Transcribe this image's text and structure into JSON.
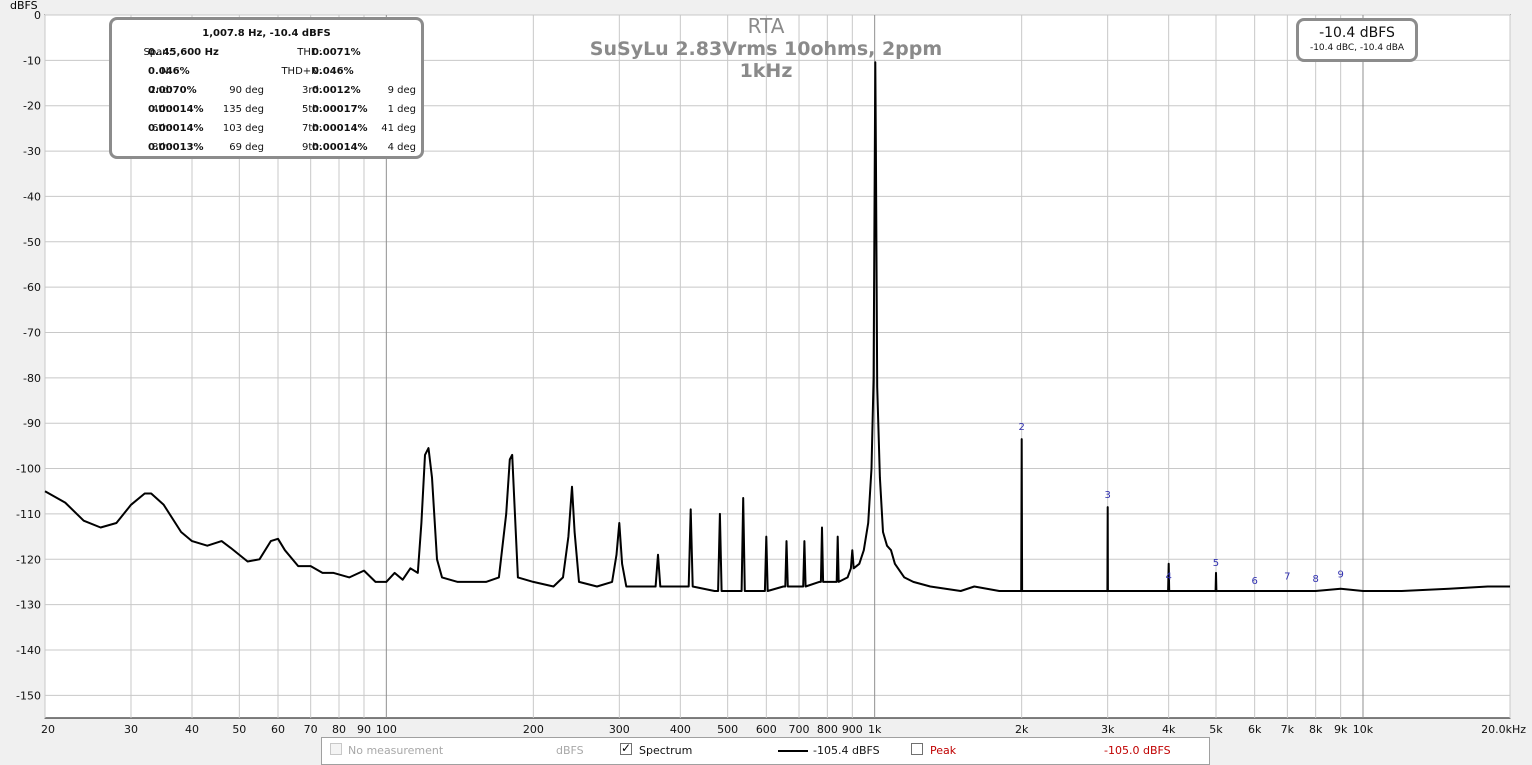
{
  "chart_data": {
    "type": "line",
    "title": "RTA",
    "subtitle": "SuSyLu 2.83Vrms 10ohms, 2ppm 1kHz",
    "ylabel": "dBFS",
    "x_scale": "log",
    "xlim": [
      20,
      20000
    ],
    "ylim": [
      -155,
      0
    ],
    "grid": true,
    "y_ticks": [
      "0",
      "-10",
      "-20",
      "-30",
      "-40",
      "-50",
      "-60",
      "-70",
      "-80",
      "-90",
      "-100",
      "-110",
      "-120",
      "-130",
      "-140",
      "-150"
    ],
    "x_ticks": [
      {
        "v": 20,
        "label": "20"
      },
      {
        "v": 30,
        "label": "30"
      },
      {
        "v": 40,
        "label": "40"
      },
      {
        "v": 50,
        "label": "50"
      },
      {
        "v": 60,
        "label": "60"
      },
      {
        "v": 70,
        "label": "70"
      },
      {
        "v": 80,
        "label": "80"
      },
      {
        "v": 90,
        "label": "90"
      },
      {
        "v": 100,
        "label": "100"
      },
      {
        "v": 200,
        "label": "200"
      },
      {
        "v": 300,
        "label": "300"
      },
      {
        "v": 400,
        "label": "400"
      },
      {
        "v": 500,
        "label": "500"
      },
      {
        "v": 600,
        "label": "600"
      },
      {
        "v": 700,
        "label": "700"
      },
      {
        "v": 800,
        "label": "800"
      },
      {
        "v": 900,
        "label": "900"
      },
      {
        "v": 1000,
        "label": "1k"
      },
      {
        "v": 2000,
        "label": "2k"
      },
      {
        "v": 3000,
        "label": "3k"
      },
      {
        "v": 4000,
        "label": "4k"
      },
      {
        "v": 5000,
        "label": "5k"
      },
      {
        "v": 6000,
        "label": "6k"
      },
      {
        "v": 7000,
        "label": "7k"
      },
      {
        "v": 8000,
        "label": "8k"
      },
      {
        "v": 9000,
        "label": "9k"
      },
      {
        "v": 10000,
        "label": "10k"
      },
      {
        "v": 20000,
        "label": "20.0kHz"
      }
    ],
    "series": [
      {
        "name": "Spectrum",
        "color": "#000000",
        "points": [
          [
            20,
            -105
          ],
          [
            22,
            -107.5
          ],
          [
            24,
            -111.5
          ],
          [
            26,
            -113
          ],
          [
            28,
            -112
          ],
          [
            30,
            -108
          ],
          [
            32,
            -105.5
          ],
          [
            33,
            -105.5
          ],
          [
            35,
            -108
          ],
          [
            38,
            -114
          ],
          [
            40,
            -116
          ],
          [
            43,
            -117
          ],
          [
            46,
            -116
          ],
          [
            48,
            -117.5
          ],
          [
            52,
            -120.5
          ],
          [
            55,
            -120
          ],
          [
            58,
            -116
          ],
          [
            60,
            -115.5
          ],
          [
            62,
            -118
          ],
          [
            66,
            -121.5
          ],
          [
            70,
            -121.5
          ],
          [
            74,
            -123
          ],
          [
            78,
            -123
          ],
          [
            84,
            -124
          ],
          [
            90,
            -122.5
          ],
          [
            95,
            -125
          ],
          [
            100,
            -125
          ],
          [
            104,
            -123
          ],
          [
            108,
            -124.5
          ],
          [
            112,
            -122
          ],
          [
            116,
            -123
          ],
          [
            118,
            -112
          ],
          [
            120,
            -97
          ],
          [
            122,
            -95.5
          ],
          [
            124,
            -102
          ],
          [
            127,
            -120
          ],
          [
            130,
            -124
          ],
          [
            140,
            -125
          ],
          [
            150,
            -125
          ],
          [
            160,
            -125
          ],
          [
            170,
            -124
          ],
          [
            176,
            -110
          ],
          [
            179,
            -98
          ],
          [
            181,
            -97
          ],
          [
            183,
            -108
          ],
          [
            186,
            -124
          ],
          [
            200,
            -125
          ],
          [
            220,
            -126
          ],
          [
            230,
            -124
          ],
          [
            236,
            -115
          ],
          [
            240,
            -104
          ],
          [
            243,
            -114
          ],
          [
            248,
            -125
          ],
          [
            270,
            -126
          ],
          [
            290,
            -125
          ],
          [
            296,
            -119
          ],
          [
            300,
            -112
          ],
          [
            304,
            -121
          ],
          [
            310,
            -126
          ],
          [
            340,
            -126
          ],
          [
            356,
            -126
          ],
          [
            360,
            -119
          ],
          [
            364,
            -126
          ],
          [
            400,
            -126
          ],
          [
            416,
            -126
          ],
          [
            420,
            -109
          ],
          [
            424,
            -126
          ],
          [
            470,
            -127
          ],
          [
            478,
            -127
          ],
          [
            482,
            -110
          ],
          [
            486,
            -127
          ],
          [
            528,
            -127
          ],
          [
            534,
            -127
          ],
          [
            538,
            -106.5
          ],
          [
            542,
            -127
          ],
          [
            590,
            -127
          ],
          [
            596,
            -127
          ],
          [
            600,
            -115
          ],
          [
            604,
            -127
          ],
          [
            650,
            -126
          ],
          [
            656,
            -126
          ],
          [
            660,
            -116
          ],
          [
            664,
            -126
          ],
          [
            708,
            -126
          ],
          [
            714,
            -126
          ],
          [
            718,
            -116
          ],
          [
            722,
            -126
          ],
          [
            770,
            -125
          ],
          [
            776,
            -125
          ],
          [
            780,
            -113
          ],
          [
            784,
            -125
          ],
          [
            830,
            -125
          ],
          [
            836,
            -125
          ],
          [
            840,
            -115
          ],
          [
            844,
            -125
          ],
          [
            880,
            -124
          ],
          [
            894,
            -122
          ],
          [
            900,
            -118
          ],
          [
            906,
            -122
          ],
          [
            930,
            -121
          ],
          [
            950,
            -118
          ],
          [
            970,
            -112
          ],
          [
            985,
            -100
          ],
          [
            995,
            -80
          ],
          [
            1000,
            -35
          ],
          [
            1003,
            -10.4
          ],
          [
            1006,
            -30
          ],
          [
            1012,
            -82
          ],
          [
            1025,
            -102
          ],
          [
            1040,
            -114
          ],
          [
            1060,
            -117
          ],
          [
            1080,
            -118
          ],
          [
            1100,
            -121
          ],
          [
            1150,
            -124
          ],
          [
            1200,
            -125
          ],
          [
            1300,
            -126
          ],
          [
            1500,
            -127
          ],
          [
            1600,
            -126
          ],
          [
            1800,
            -127
          ],
          [
            1990,
            -127
          ],
          [
            1996,
            -127
          ],
          [
            2000,
            -93.5
          ],
          [
            2004,
            -127
          ],
          [
            2200,
            -127
          ],
          [
            2500,
            -127
          ],
          [
            2990,
            -127
          ],
          [
            2996,
            -127
          ],
          [
            3000,
            -108.5
          ],
          [
            3004,
            -127
          ],
          [
            3400,
            -127
          ],
          [
            3990,
            -127
          ],
          [
            4000,
            -121
          ],
          [
            4010,
            -127
          ],
          [
            4990,
            -127
          ],
          [
            5000,
            -123
          ],
          [
            5010,
            -127
          ],
          [
            6000,
            -127
          ],
          [
            7000,
            -127
          ],
          [
            8000,
            -127
          ],
          [
            9000,
            -126.5
          ],
          [
            10000,
            -127
          ],
          [
            12000,
            -127
          ],
          [
            15000,
            -126.5
          ],
          [
            18000,
            -126
          ],
          [
            20000,
            -126
          ]
        ]
      }
    ],
    "harmonic_markers": [
      {
        "label": "2",
        "freq": 2000,
        "db": -91.5
      },
      {
        "label": "3",
        "freq": 3000,
        "db": -106.5
      },
      {
        "label": "4",
        "freq": 4000,
        "db": -124.5
      },
      {
        "label": "5",
        "freq": 5000,
        "db": -121.5
      },
      {
        "label": "6",
        "freq": 6000,
        "db": -125.5
      },
      {
        "label": "7",
        "freq": 7000,
        "db": -124.5
      },
      {
        "label": "8",
        "freq": 8000,
        "db": -125
      },
      {
        "label": "9",
        "freq": 9000,
        "db": -124
      }
    ]
  },
  "stats_box": {
    "header": "1,007.8 Hz, -10.4 dBFS",
    "rows": [
      {
        "l1": "Span:",
        "v1": "0..45,600 Hz",
        "d1": "",
        "l2": "THD:",
        "v2": "0.0071%",
        "d2": ""
      },
      {
        "l1": "N:",
        "v1": "0.046%",
        "d1": "",
        "l2": "THD+N:",
        "v2": "0.046%",
        "d2": ""
      },
      {
        "l1": "2nd:",
        "v1": "0.0070%",
        "d1": "90 deg",
        "l2": "3rd:",
        "v2": "0.0012%",
        "d2": "9 deg"
      },
      {
        "l1": "4th:",
        "v1": "0.00014%",
        "d1": "135 deg",
        "l2": "5th:",
        "v2": "0.00017%",
        "d2": "1 deg"
      },
      {
        "l1": "6th:",
        "v1": "0.00014%",
        "d1": "103 deg",
        "l2": "7th:",
        "v2": "0.00014%",
        "d2": "41 deg"
      },
      {
        "l1": "8th:",
        "v1": "0.00013%",
        "d1": "69 deg",
        "l2": "9th:",
        "v2": "0.00014%",
        "d2": "4 deg"
      }
    ]
  },
  "level_box": {
    "main": "-10.4 dBFS",
    "sub": "-10.4 dBC, -10.4 dBA"
  },
  "legend": {
    "no_measurement": "No measurement",
    "unit": "dBFS",
    "spectrum": "Spectrum",
    "spectrum_value": "-105.4 dBFS",
    "peak": "Peak",
    "peak_value": "-105.0 dBFS",
    "peak_color": "#c00000",
    "spectrum_checked": true,
    "peak_checked": false
  }
}
